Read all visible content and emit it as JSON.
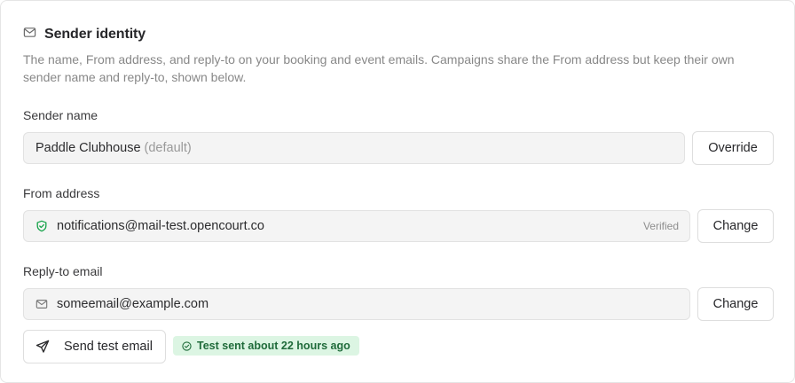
{
  "section": {
    "title": "Sender identity",
    "description": "The name, From address, and reply-to on your booking and event emails. Campaigns share the From address but keep their own sender name and reply-to, shown below."
  },
  "sender_name": {
    "label": "Sender name",
    "value": "Paddle Clubhouse",
    "suffix": "(default)",
    "button": "Override"
  },
  "from_address": {
    "label": "From address",
    "value": "notifications@mail-test.opencourt.co",
    "status": "Verified",
    "button": "Change"
  },
  "reply_to": {
    "label": "Reply-to email",
    "value": "someemail@example.com",
    "button": "Change"
  },
  "test": {
    "button": "Send test email",
    "badge": "Test sent about 22 hours ago"
  },
  "icons": {
    "section": "mail-icon",
    "from": "shield-check-icon",
    "reply": "mail-icon",
    "send": "send-icon",
    "badge": "check-circle-icon"
  },
  "colors": {
    "verified_icon": "#16a34a",
    "badge_bg": "#dcf5e3",
    "badge_text": "#1f6b3a"
  }
}
